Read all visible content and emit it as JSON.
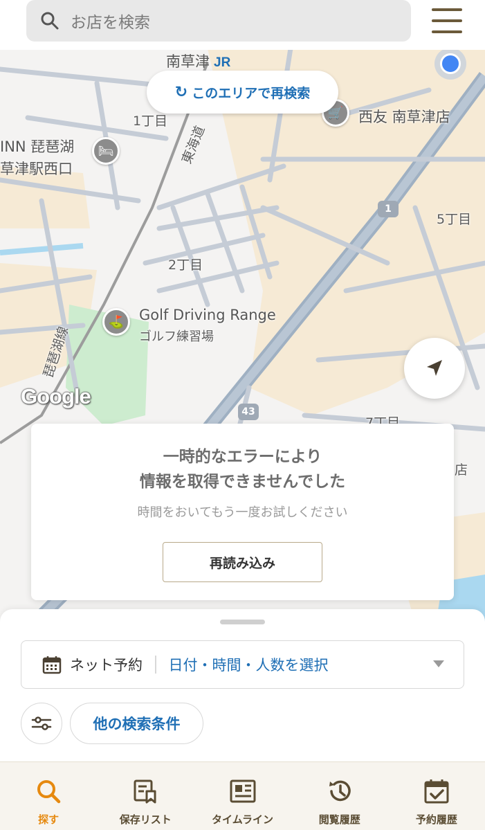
{
  "search": {
    "placeholder": "お店を検索",
    "icon": "search-icon"
  },
  "menu": {
    "icon": "hamburger-menu-icon"
  },
  "map": {
    "research_button": "このエリアで再検索",
    "station": "南草津",
    "station_badge": "JR",
    "labels": {
      "chome1": "1丁目",
      "chome2": "2丁目",
      "chome5": "5丁目",
      "chome7": "7丁目",
      "tokaido": "東海道",
      "biwako_line": "琵琶湖線",
      "store_name": "西友 南草津店",
      "hotel_line1": "INN 琵琶湖",
      "hotel_line2": "草津駅西口",
      "golf_en": "Golf Driving Range",
      "golf_ja": "ゴルフ練習場",
      "store_partial": "店",
      "route1": "1",
      "route43": "43",
      "google": "Google"
    }
  },
  "error": {
    "title_line1": "一時的なエラーにより",
    "title_line2": "情報を取得できませんでした",
    "subtitle": "時間をおいてもう一度お試しください",
    "reload_label": "再読み込み"
  },
  "sheet": {
    "reserve_label": "ネット予約",
    "reserve_value": "日付・時間・人数を選択",
    "other_conditions": "他の検索条件"
  },
  "nav": {
    "items": [
      {
        "label": "探す",
        "icon": "search-icon",
        "active": true
      },
      {
        "label": "保存リスト",
        "icon": "bookmark-list-icon",
        "active": false
      },
      {
        "label": "タイムライン",
        "icon": "timeline-icon",
        "active": false
      },
      {
        "label": "閲覧履歴",
        "icon": "history-icon",
        "active": false
      },
      {
        "label": "予約履歴",
        "icon": "calendar-check-icon",
        "active": false
      }
    ]
  },
  "colors": {
    "accent": "#e6890f",
    "link": "#1f6fb5",
    "brand_brown": "#6b5a3a"
  }
}
